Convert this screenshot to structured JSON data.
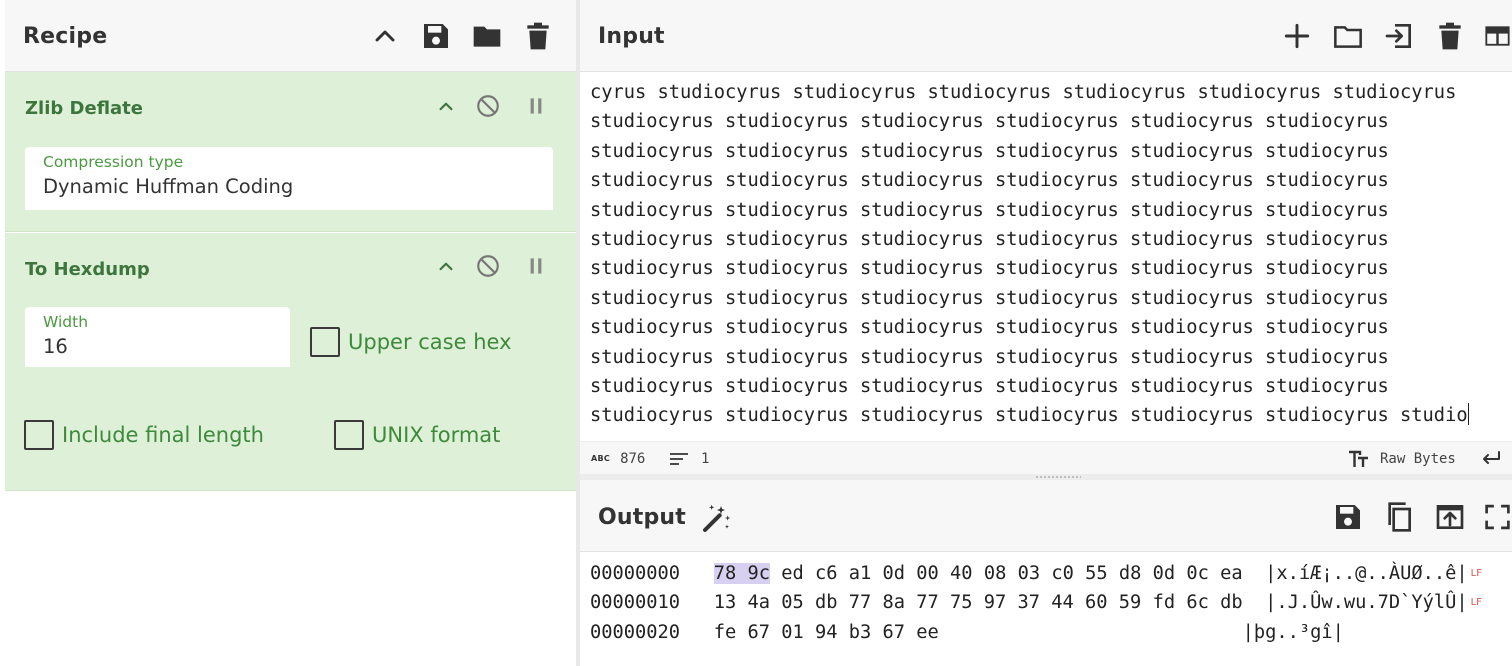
{
  "recipe": {
    "title": "Recipe",
    "icons": [
      "chevron-up-icon",
      "save-icon",
      "folder-icon",
      "trash-icon"
    ],
    "operations": [
      {
        "name": "Zlib Deflate",
        "fields": [
          {
            "label": "Compression type",
            "value": "Dynamic Huffman Coding"
          }
        ]
      },
      {
        "name": "To Hexdump",
        "fields": [
          {
            "label": "Width",
            "value": "16"
          }
        ],
        "checkboxes": [
          {
            "label": "Upper case hex",
            "checked": false
          },
          {
            "label": "Include final length",
            "checked": false
          },
          {
            "label": "UNIX format",
            "checked": false
          }
        ]
      }
    ]
  },
  "input": {
    "title": "Input",
    "icons": [
      "plus-icon",
      "folder-icon",
      "load-icon",
      "trash-icon",
      "layout-icon"
    ],
    "lines": [
      "cyrus studiocyrus studiocyrus studiocyrus studiocyrus studiocyrus studiocyrus",
      "studiocyrus studiocyrus studiocyrus studiocyrus studiocyrus studiocyrus",
      "studiocyrus studiocyrus studiocyrus studiocyrus studiocyrus studiocyrus",
      "studiocyrus studiocyrus studiocyrus studiocyrus studiocyrus studiocyrus",
      "studiocyrus studiocyrus studiocyrus studiocyrus studiocyrus studiocyrus",
      "studiocyrus studiocyrus studiocyrus studiocyrus studiocyrus studiocyrus",
      "studiocyrus studiocyrus studiocyrus studiocyrus studiocyrus studiocyrus",
      "studiocyrus studiocyrus studiocyrus studiocyrus studiocyrus studiocyrus",
      "studiocyrus studiocyrus studiocyrus studiocyrus studiocyrus studiocyrus",
      "studiocyrus studiocyrus studiocyrus studiocyrus studiocyrus studiocyrus",
      "studiocyrus studiocyrus studiocyrus studiocyrus studiocyrus studiocyrus",
      "studiocyrus studiocyrus studiocyrus studiocyrus studiocyrus studiocyrus studio"
    ],
    "status": {
      "length_label": "ABC",
      "length": "876",
      "line_count": "1",
      "encoding": "Raw Bytes"
    }
  },
  "output": {
    "title": "Output",
    "icons": [
      "magic-wand-icon",
      "save-icon",
      "copy-icon",
      "replace-input-icon",
      "maximise-icon"
    ],
    "rows": [
      {
        "offset": "00000000",
        "hl": "78 9c",
        "hex": " ed c6 a1 0d 00 40 08 03 c0 55 d8 0d 0c ea",
        "ascii": "|x.íÆ¡..@..ÀUØ..ê|",
        "lf": "LF"
      },
      {
        "offset": "00000010",
        "hl": "",
        "hex": "13 4a 05 db 77 8a 77 75 97 37 44 60 59 fd 6c db",
        "ascii": "|.J.Ûw.wu.7D`YýlÛ|",
        "lf": "LF"
      },
      {
        "offset": "00000020",
        "hl": "",
        "hex": "fe 67 01 94 b3 67 ee",
        "ascii": "|þg..³gî|",
        "lf": ""
      }
    ]
  }
}
